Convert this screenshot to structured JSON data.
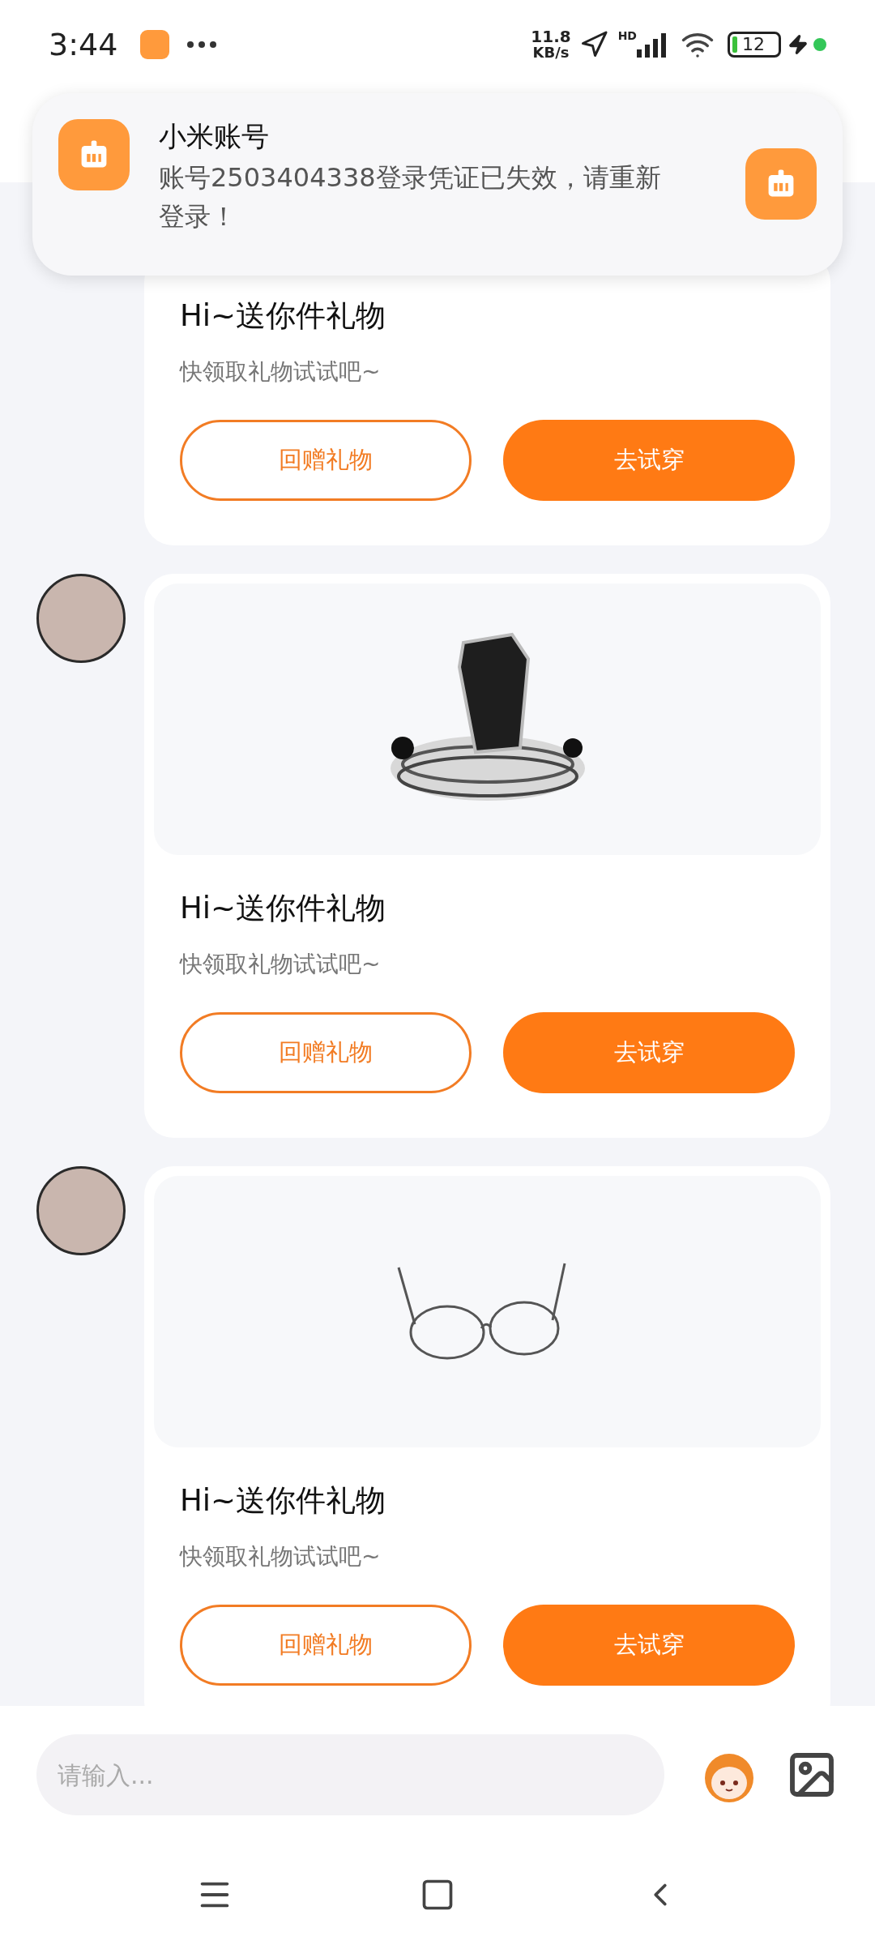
{
  "status_bar": {
    "time": "3:44",
    "speed_value": "11.8",
    "speed_unit": "KB/s",
    "network_label": "HD",
    "battery": "12"
  },
  "notification": {
    "title": "小米账号",
    "body": "账号2503404338登录凭证已失效，请重新登录！"
  },
  "messages": [
    {
      "avatar": false,
      "title": "Hi~送你件礼物",
      "subtitle": "快领取礼物试试吧~",
      "buttons": [
        "回赠礼物",
        "去试穿"
      ]
    },
    {
      "avatar": true,
      "kind": "coffin",
      "title": "Hi~送你件礼物",
      "subtitle": "快领取礼物试试吧~",
      "buttons": [
        "回赠礼物",
        "去试穿"
      ]
    },
    {
      "avatar": true,
      "kind": "glasses",
      "title": "Hi~送你件礼物",
      "subtitle": "快领取礼物试试吧~",
      "buttons": [
        "回赠礼物",
        "去试穿"
      ]
    }
  ],
  "composer": {
    "placeholder": "请输入..."
  }
}
